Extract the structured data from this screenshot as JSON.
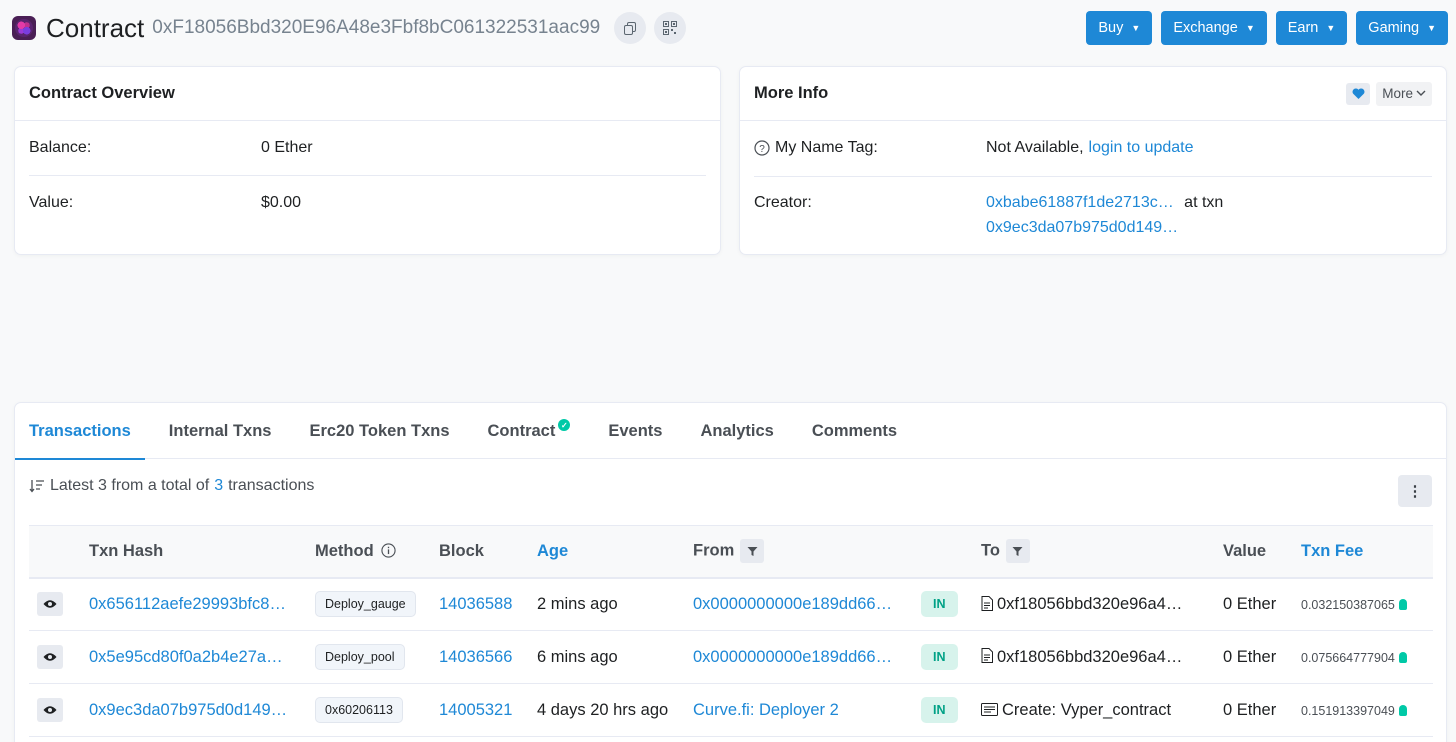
{
  "header": {
    "title": "Contract",
    "address": "0xF18056Bbd320E96A48e3Fbf8bC061322531aac99",
    "menu": [
      {
        "label": "Buy",
        "name": "buy-button"
      },
      {
        "label": "Exchange",
        "name": "exchange-button"
      },
      {
        "label": "Earn",
        "name": "earn-button"
      },
      {
        "label": "Gaming",
        "name": "gaming-button"
      }
    ]
  },
  "overview": {
    "title": "Contract Overview",
    "balance_label": "Balance:",
    "balance_value": "0 Ether",
    "value_label": "Value:",
    "value_value": "$0.00"
  },
  "more_info": {
    "title": "More Info",
    "more_label": "More",
    "name_tag_label": "My Name Tag:",
    "name_tag_value": "Not Available,",
    "name_tag_link": "login to update",
    "creator_label": "Creator:",
    "creator_address": "0xbabe61887f1de2713c…",
    "creator_at": "at txn",
    "creator_txn": "0x9ec3da07b975d0d149…"
  },
  "tabs": [
    "Transactions",
    "Internal Txns",
    "Erc20 Token Txns",
    "Contract",
    "Events",
    "Analytics",
    "Comments"
  ],
  "summary": {
    "prefix": "Latest 3 from a total of",
    "count": "3",
    "suffix": "transactions"
  },
  "table": {
    "headers": {
      "hash": "Txn Hash",
      "method": "Method",
      "block": "Block",
      "age": "Age",
      "from": "From",
      "to": "To",
      "value": "Value",
      "fee": "Txn Fee"
    },
    "rows": [
      {
        "hash": "0x656112aefe29993bfc8…",
        "method": "Deploy_gauge",
        "block": "14036588",
        "age": "2 mins ago",
        "from": "0x0000000000e189dd66…",
        "direction": "IN",
        "to": "0xf18056bbd320e96a48…",
        "value": "0 Ether",
        "fee": "0.032150387065"
      },
      {
        "hash": "0x5e95cd80f0a2b4e27a…",
        "method": "Deploy_pool",
        "block": "14036566",
        "age": "6 mins ago",
        "from": "0x0000000000e189dd66…",
        "direction": "IN",
        "to": "0xf18056bbd320e96a48…",
        "value": "0 Ether",
        "fee": "0.075664777904"
      },
      {
        "hash": "0x9ec3da07b975d0d149…",
        "method": "0x60206113",
        "block": "14005321",
        "age": "4 days 20 hrs ago",
        "from": "Curve.fi: Deployer 2",
        "direction": "IN",
        "to": "Create: Vyper_contract",
        "value": "0 Ether",
        "fee": "0.151913397049"
      }
    ]
  }
}
